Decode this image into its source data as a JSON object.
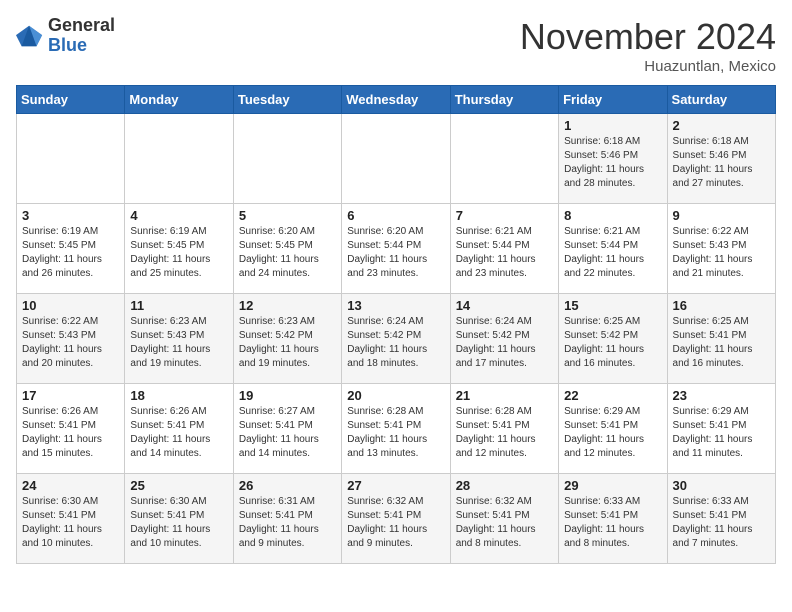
{
  "logo": {
    "general": "General",
    "blue": "Blue"
  },
  "title": "November 2024",
  "location": "Huazuntlan, Mexico",
  "days_of_week": [
    "Sunday",
    "Monday",
    "Tuesday",
    "Wednesday",
    "Thursday",
    "Friday",
    "Saturday"
  ],
  "weeks": [
    [
      {
        "day": "",
        "info": ""
      },
      {
        "day": "",
        "info": ""
      },
      {
        "day": "",
        "info": ""
      },
      {
        "day": "",
        "info": ""
      },
      {
        "day": "",
        "info": ""
      },
      {
        "day": "1",
        "info": "Sunrise: 6:18 AM\nSunset: 5:46 PM\nDaylight: 11 hours\nand 28 minutes."
      },
      {
        "day": "2",
        "info": "Sunrise: 6:18 AM\nSunset: 5:46 PM\nDaylight: 11 hours\nand 27 minutes."
      }
    ],
    [
      {
        "day": "3",
        "info": "Sunrise: 6:19 AM\nSunset: 5:45 PM\nDaylight: 11 hours\nand 26 minutes."
      },
      {
        "day": "4",
        "info": "Sunrise: 6:19 AM\nSunset: 5:45 PM\nDaylight: 11 hours\nand 25 minutes."
      },
      {
        "day": "5",
        "info": "Sunrise: 6:20 AM\nSunset: 5:45 PM\nDaylight: 11 hours\nand 24 minutes."
      },
      {
        "day": "6",
        "info": "Sunrise: 6:20 AM\nSunset: 5:44 PM\nDaylight: 11 hours\nand 23 minutes."
      },
      {
        "day": "7",
        "info": "Sunrise: 6:21 AM\nSunset: 5:44 PM\nDaylight: 11 hours\nand 23 minutes."
      },
      {
        "day": "8",
        "info": "Sunrise: 6:21 AM\nSunset: 5:44 PM\nDaylight: 11 hours\nand 22 minutes."
      },
      {
        "day": "9",
        "info": "Sunrise: 6:22 AM\nSunset: 5:43 PM\nDaylight: 11 hours\nand 21 minutes."
      }
    ],
    [
      {
        "day": "10",
        "info": "Sunrise: 6:22 AM\nSunset: 5:43 PM\nDaylight: 11 hours\nand 20 minutes."
      },
      {
        "day": "11",
        "info": "Sunrise: 6:23 AM\nSunset: 5:43 PM\nDaylight: 11 hours\nand 19 minutes."
      },
      {
        "day": "12",
        "info": "Sunrise: 6:23 AM\nSunset: 5:42 PM\nDaylight: 11 hours\nand 19 minutes."
      },
      {
        "day": "13",
        "info": "Sunrise: 6:24 AM\nSunset: 5:42 PM\nDaylight: 11 hours\nand 18 minutes."
      },
      {
        "day": "14",
        "info": "Sunrise: 6:24 AM\nSunset: 5:42 PM\nDaylight: 11 hours\nand 17 minutes."
      },
      {
        "day": "15",
        "info": "Sunrise: 6:25 AM\nSunset: 5:42 PM\nDaylight: 11 hours\nand 16 minutes."
      },
      {
        "day": "16",
        "info": "Sunrise: 6:25 AM\nSunset: 5:41 PM\nDaylight: 11 hours\nand 16 minutes."
      }
    ],
    [
      {
        "day": "17",
        "info": "Sunrise: 6:26 AM\nSunset: 5:41 PM\nDaylight: 11 hours\nand 15 minutes."
      },
      {
        "day": "18",
        "info": "Sunrise: 6:26 AM\nSunset: 5:41 PM\nDaylight: 11 hours\nand 14 minutes."
      },
      {
        "day": "19",
        "info": "Sunrise: 6:27 AM\nSunset: 5:41 PM\nDaylight: 11 hours\nand 14 minutes."
      },
      {
        "day": "20",
        "info": "Sunrise: 6:28 AM\nSunset: 5:41 PM\nDaylight: 11 hours\nand 13 minutes."
      },
      {
        "day": "21",
        "info": "Sunrise: 6:28 AM\nSunset: 5:41 PM\nDaylight: 11 hours\nand 12 minutes."
      },
      {
        "day": "22",
        "info": "Sunrise: 6:29 AM\nSunset: 5:41 PM\nDaylight: 11 hours\nand 12 minutes."
      },
      {
        "day": "23",
        "info": "Sunrise: 6:29 AM\nSunset: 5:41 PM\nDaylight: 11 hours\nand 11 minutes."
      }
    ],
    [
      {
        "day": "24",
        "info": "Sunrise: 6:30 AM\nSunset: 5:41 PM\nDaylight: 11 hours\nand 10 minutes."
      },
      {
        "day": "25",
        "info": "Sunrise: 6:30 AM\nSunset: 5:41 PM\nDaylight: 11 hours\nand 10 minutes."
      },
      {
        "day": "26",
        "info": "Sunrise: 6:31 AM\nSunset: 5:41 PM\nDaylight: 11 hours\nand 9 minutes."
      },
      {
        "day": "27",
        "info": "Sunrise: 6:32 AM\nSunset: 5:41 PM\nDaylight: 11 hours\nand 9 minutes."
      },
      {
        "day": "28",
        "info": "Sunrise: 6:32 AM\nSunset: 5:41 PM\nDaylight: 11 hours\nand 8 minutes."
      },
      {
        "day": "29",
        "info": "Sunrise: 6:33 AM\nSunset: 5:41 PM\nDaylight: 11 hours\nand 8 minutes."
      },
      {
        "day": "30",
        "info": "Sunrise: 6:33 AM\nSunset: 5:41 PM\nDaylight: 11 hours\nand 7 minutes."
      }
    ]
  ]
}
